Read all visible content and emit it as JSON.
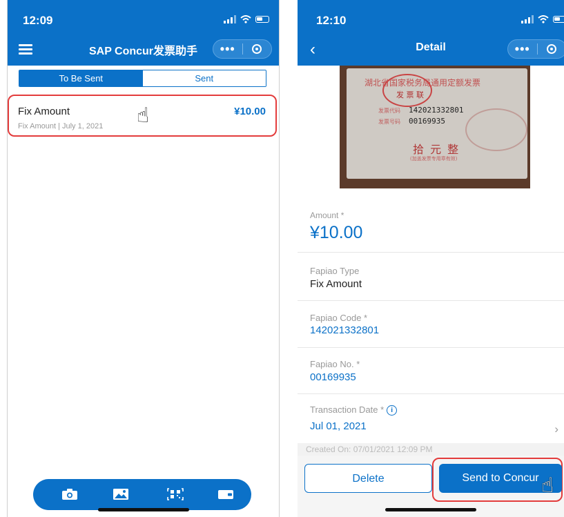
{
  "left_screen": {
    "status": {
      "time": "12:09"
    },
    "nav": {
      "title": "SAP Concur发票助手"
    },
    "tabs": [
      {
        "label": "To Be Sent",
        "active": true
      },
      {
        "label": "Sent",
        "active": false
      }
    ],
    "invoice": {
      "title": "Fix Amount",
      "subtitle": "Fix Amount | July 1, 2021",
      "amount": "¥10.00"
    },
    "toolbar_icons": [
      "camera-icon",
      "image-icon",
      "qr-scan-icon",
      "card-icon"
    ]
  },
  "right_screen": {
    "status": {
      "time": "12:10"
    },
    "nav": {
      "title": "Detail"
    },
    "receipt_image": {
      "header_text": "湖北省国家税务局通用定额发票",
      "stamp_text": "发 票 联",
      "code_label": "发票代码",
      "code_value": "142021332801",
      "number_label": "发票号码",
      "number_value": "00169935",
      "amount_text": "拾 元 整",
      "note_text": "(加盖发票专用章有效)"
    },
    "fields": {
      "amount": {
        "label": "Amount *",
        "value": "¥10.00"
      },
      "type": {
        "label": "Fapiao Type",
        "value": "Fix Amount"
      },
      "code": {
        "label": "Fapiao Code *",
        "value": "142021332801"
      },
      "number": {
        "label": "Fapiao No. *",
        "value": "00169935"
      },
      "date": {
        "label": "Transaction Date *",
        "value": "Jul 01, 2021"
      }
    },
    "created_on": "Created On: 07/01/2021 12:09 PM",
    "buttons": {
      "delete": "Delete",
      "send": "Send to Concur"
    }
  },
  "colors": {
    "primary": "#0b71c8",
    "highlight": "#e33b3b"
  }
}
